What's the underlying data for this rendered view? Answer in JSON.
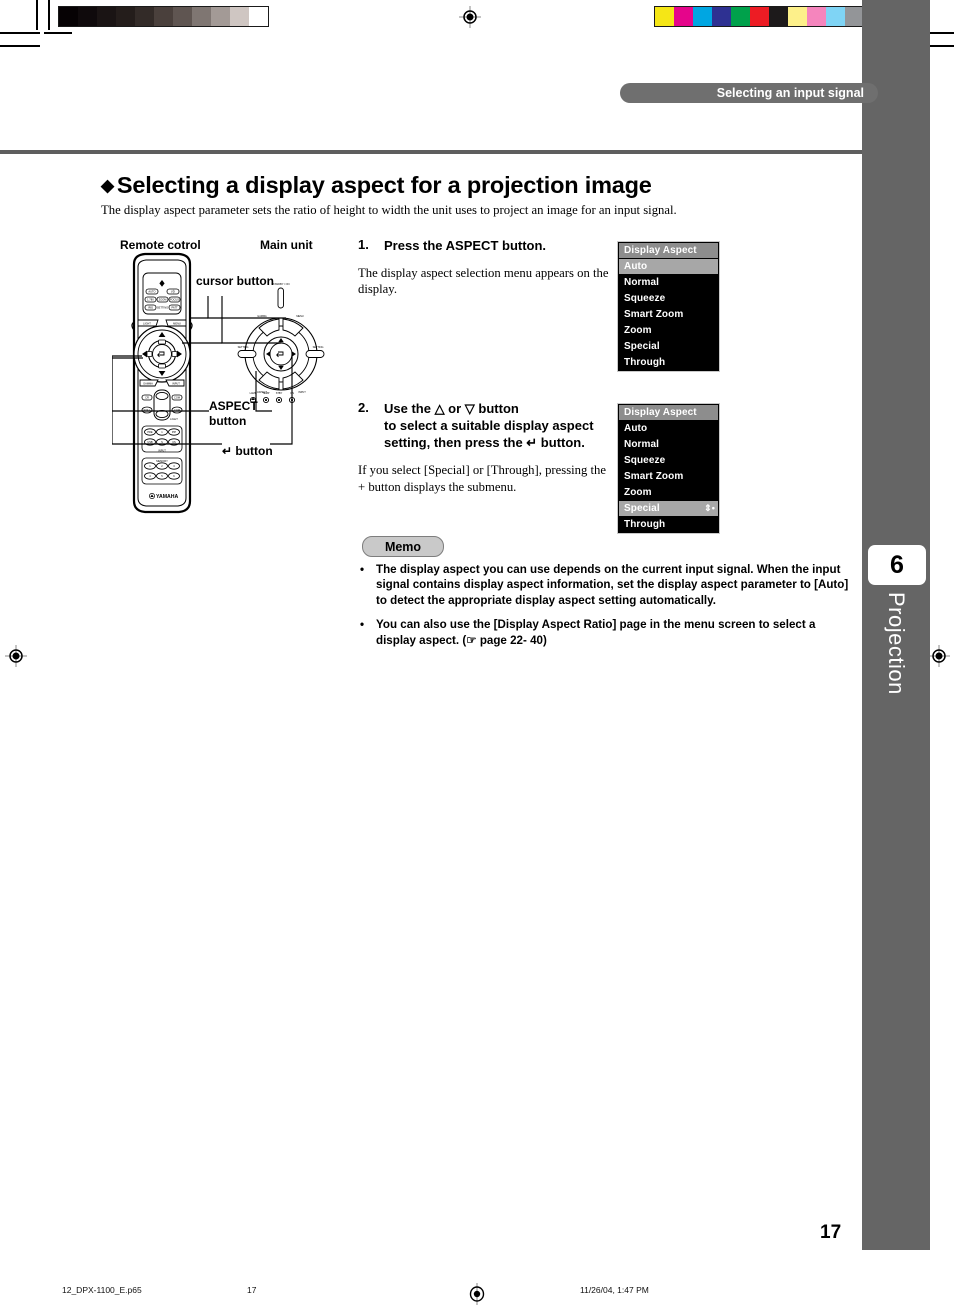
{
  "page": {
    "running_head": "Selecting an input signal",
    "page_number": "17",
    "chapter_number": "6",
    "chapter_name": "Projection"
  },
  "heading": {
    "bullet": "◆",
    "title": "Selecting a display aspect for a projection image",
    "lead": "The display aspect parameter sets the ratio of height to width the unit uses to project an image for an input signal."
  },
  "figure": {
    "label_remote": "Remote cotrol",
    "label_main_unit": "Main unit",
    "callout_cursor": "cursor button",
    "callout_aspect_line1": "ASPECT",
    "callout_aspect_line2": "button",
    "callout_enter": "↵ button",
    "remote_brand": "YAMAHA",
    "remote_buttons": {
      "row1": [
        "AUTO",
        "⬤/I"
      ],
      "row2": [
        "1.78X",
        "ZOOM",
        "FOCUS"
      ],
      "row3": [
        "IRIS",
        "SETTING",
        "PATT"
      ],
      "shoulder_left": "LIGHT",
      "shoulder_right": "MENU",
      "mid_left": "GAMMA",
      "mid_right": "INPUT",
      "sub_left": "CR",
      "sub_right": "COM",
      "still": "STILL",
      "light": "LIGHT",
      "input_group": "INPUT",
      "input_row1": [
        "PRE",
        "1",
        "PIP"
      ],
      "input_row2": [
        "USB",
        "S",
        "CS"
      ],
      "memory_group": "MEMORY",
      "memory_row1": [
        "1",
        "2",
        "3"
      ],
      "memory_row2": [
        "4",
        "5",
        "6"
      ]
    },
    "main_unit_labels": {
      "standby": "STANDBY / ON",
      "gamma": "GAMMA",
      "menu": "MENU",
      "setting_left": "SETTING",
      "setting_right": "SETTING",
      "aspect": "ASPECT",
      "input": "INPUT",
      "indicators": [
        "LAMP",
        "TEMP",
        "STANDBY",
        "ON"
      ]
    }
  },
  "steps": [
    {
      "number": "1.",
      "heading": "Press the ASPECT button.",
      "body": "The display aspect selection menu appears on the display."
    },
    {
      "number": "2.",
      "heading_line1": "Use the △ or ▽ button",
      "heading_line2": "to select a suitable display aspect",
      "heading_line3": "setting, then press the ↵ button.",
      "body": "If you select [Special] or [Through], pressing the + button displays the submenu."
    }
  ],
  "osd_menus": [
    {
      "title": "Display Aspect Ratio",
      "selected": "Auto",
      "items": [
        "Auto",
        "Normal",
        "Squeeze",
        "Smart Zoom",
        "Zoom",
        "Special",
        "Through"
      ],
      "marks": ""
    },
    {
      "title": "Display Aspect Ratio",
      "selected": "Special",
      "items": [
        "Auto",
        "Normal",
        "Squeeze",
        "Smart Zoom",
        "Zoom",
        "Special",
        "Through"
      ],
      "marks": "⇕•"
    }
  ],
  "memo": {
    "label": "Memo",
    "bullet": "•",
    "items": [
      "The display aspect you can use depends on the current input signal. When the input signal contains display aspect information, set the display aspect parameter to [Auto] to detect the appropriate display aspect setting automatically.",
      "You can also use the [Display Aspect Ratio] page in the menu screen to select a display aspect. (☞ page 22- 40)"
    ]
  },
  "footer": {
    "filename": "12_DPX-1100_E.p65",
    "page": "17",
    "timestamp": "11/26/04, 1:47 PM"
  },
  "calibration": {
    "gray_wedge": [
      "#060204",
      "#0f0a0c",
      "#1a1414",
      "#241d1b",
      "#332b28",
      "#4a403c",
      "#5f5551",
      "#7f7672",
      "#a39a96",
      "#cfc6c2",
      "#ffffff"
    ],
    "color_bars": [
      "#f5e616",
      "#e5058b",
      "#00a6e2",
      "#2e3192",
      "#00a14b",
      "#ed1c24",
      "#1d1a1b",
      "#fdf08a",
      "#f585bd",
      "#7fd4f5",
      "#939598"
    ]
  },
  "colors": {
    "band_gray": "#656565",
    "runhead_gray": "#6f6f6f",
    "osd_title_gray": "#8d8d8d",
    "osd_select_gray": "#a7a7a7"
  }
}
